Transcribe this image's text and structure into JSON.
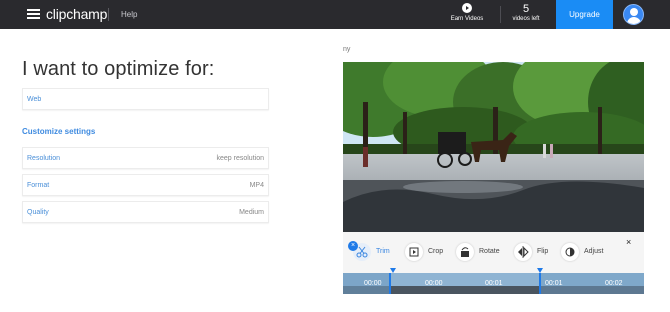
{
  "topbar": {
    "logo": "clipchamp",
    "help": "Help",
    "earn_label": "Earn Videos",
    "videos_count": "5",
    "videos_label": "videos left",
    "upgrade": "Upgrade"
  },
  "main": {
    "heading": "I want to optimize for:",
    "optimize_option": "Web",
    "customize_link": "Customize settings",
    "settings": [
      {
        "key": "Resolution",
        "value": "keep resolution"
      },
      {
        "key": "Format",
        "value": "MP4"
      },
      {
        "key": "Quality",
        "value": "Medium"
      }
    ]
  },
  "preview": {
    "filename": "ny",
    "tools": [
      "Trim",
      "Crop",
      "Rotate",
      "Flip",
      "Adjust"
    ],
    "close": "×",
    "timecodes": [
      "00:00",
      "00:00",
      "00:01",
      "00:01",
      "00:02"
    ]
  },
  "colors": {
    "topbar_bg": "#2a2a2e",
    "accent": "#1a8cf5",
    "link": "#4a8fd8"
  }
}
